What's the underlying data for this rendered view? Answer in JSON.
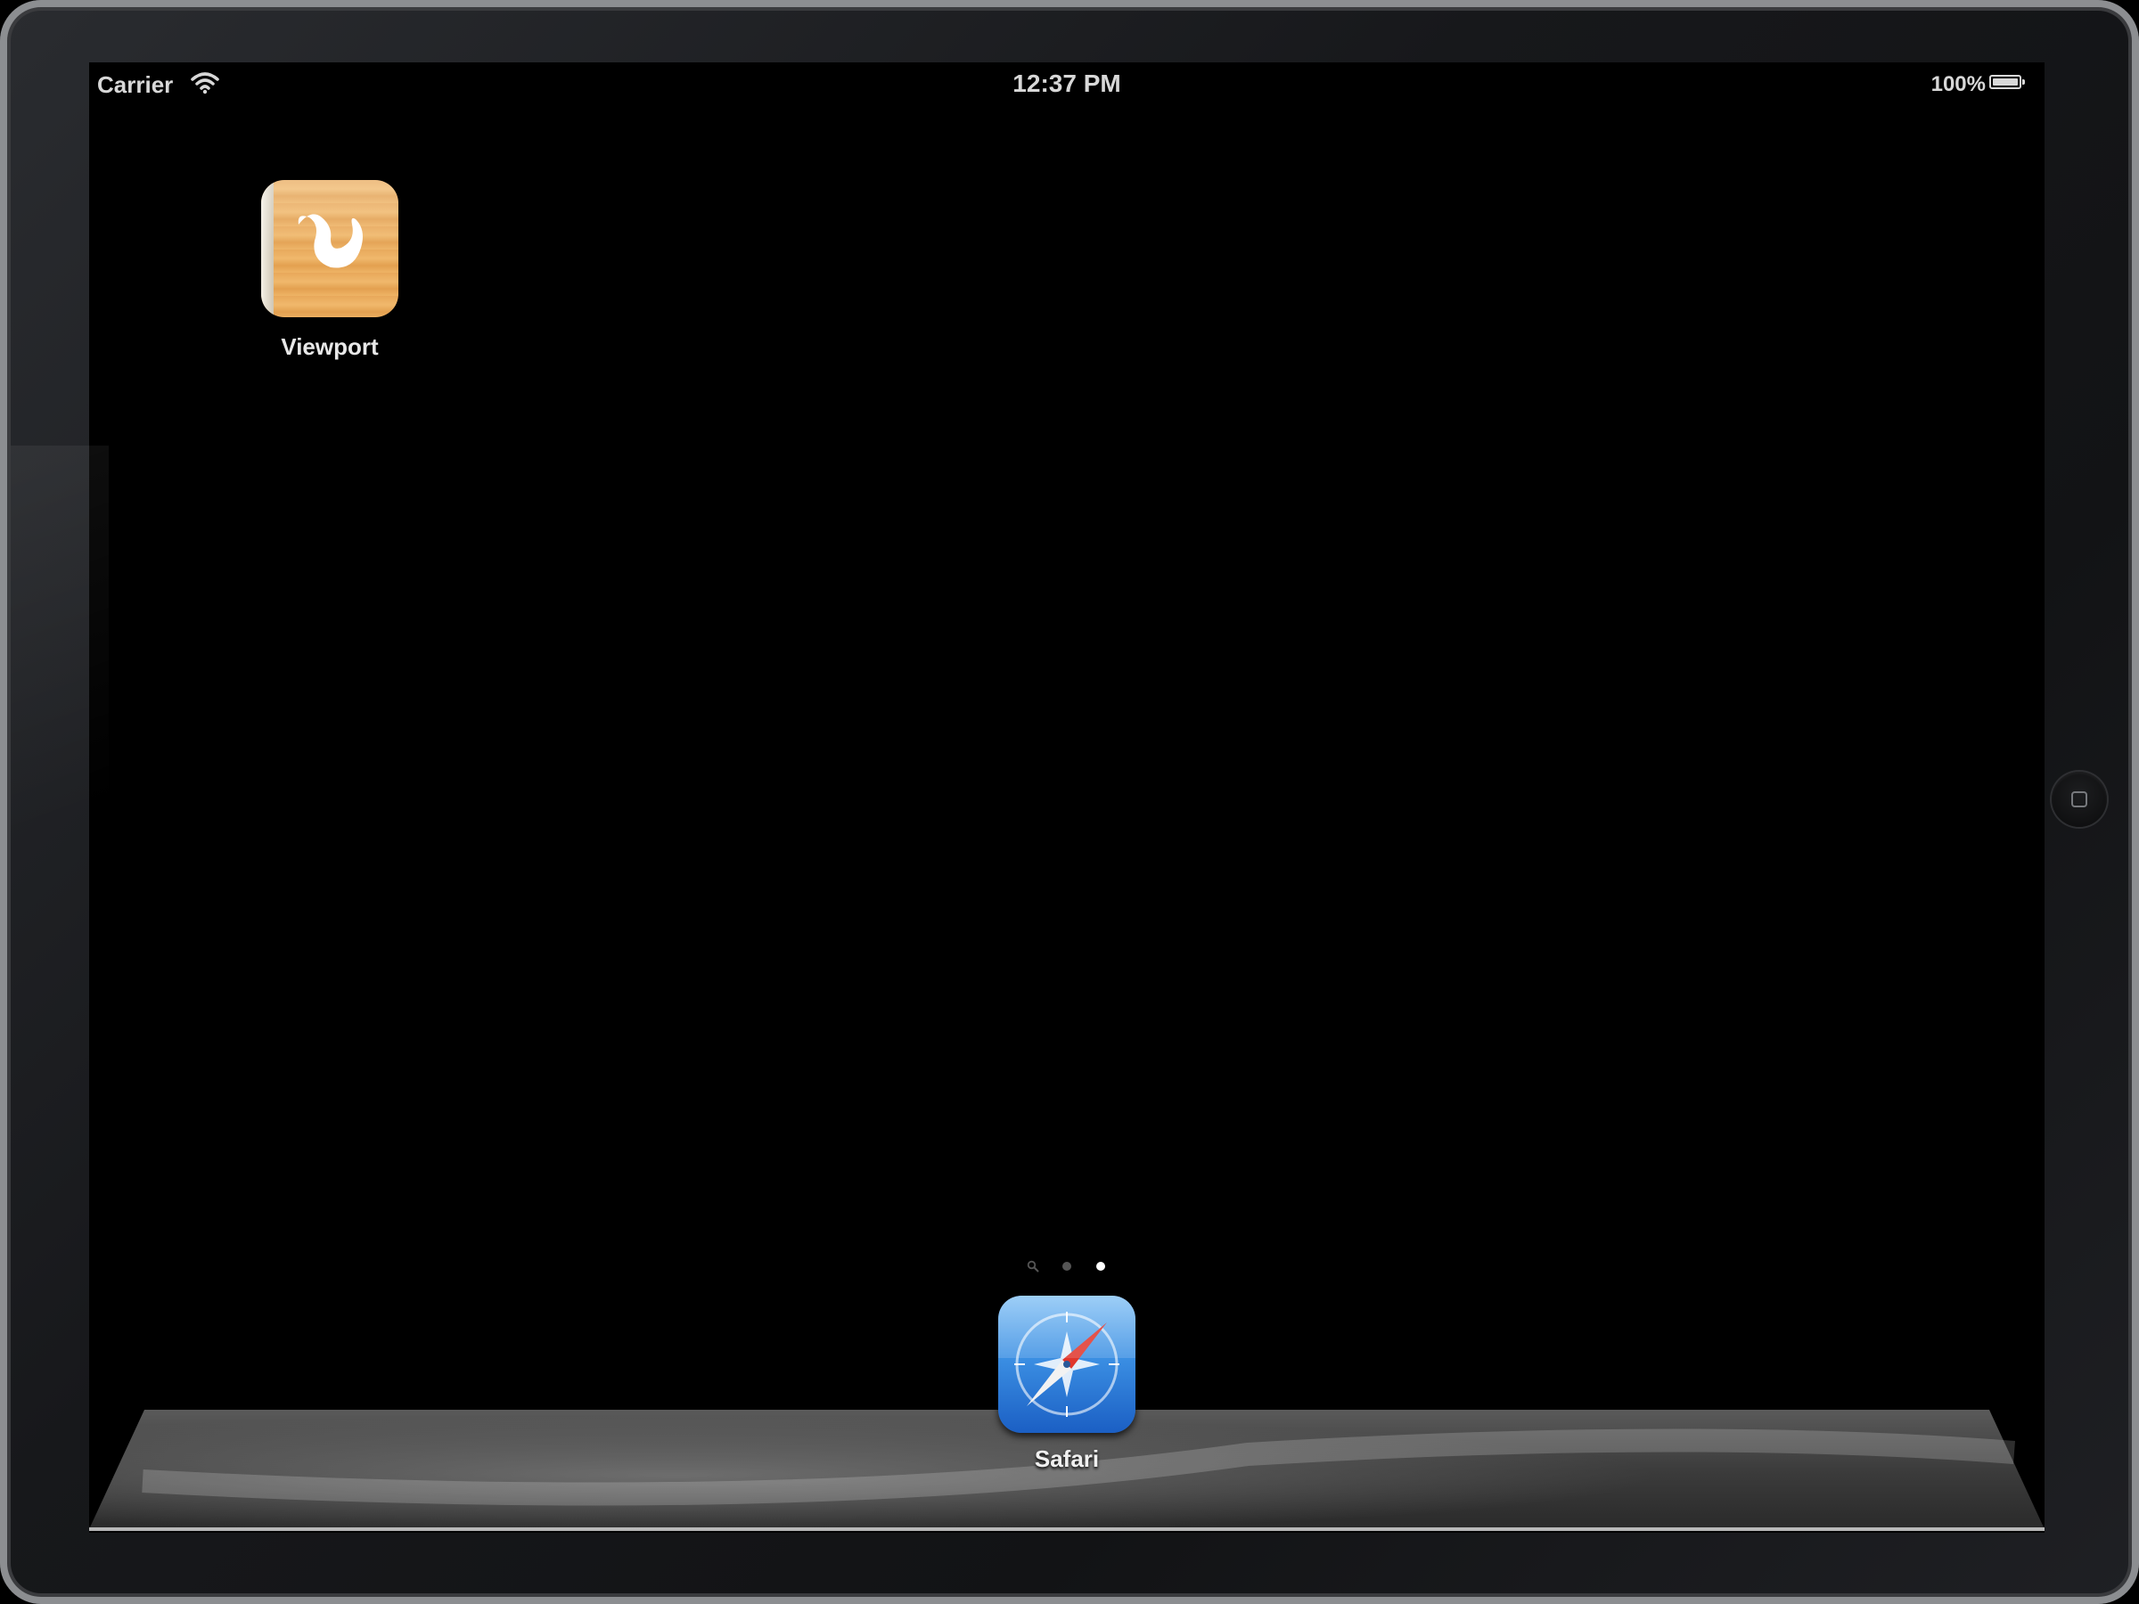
{
  "status_bar": {
    "carrier": "Carrier",
    "time": "12:37 PM",
    "battery_percent": "100%",
    "battery_level": 1.0
  },
  "home_screen": {
    "apps": [
      {
        "label": "Viewport",
        "icon": "viewport-icon"
      }
    ],
    "page_indicator": {
      "pages": 3,
      "current_page": 3,
      "first_is_spotlight": true
    }
  },
  "dock": {
    "apps": [
      {
        "label": "Safari",
        "icon": "safari-compass-icon"
      }
    ]
  },
  "hardware": {
    "home_button": "home-button-icon"
  },
  "colors": {
    "background": "#000000",
    "bezel": "#17181b",
    "bezel_edge": "#8c8e91",
    "label": "#e8e8e8",
    "active_dot": "#ffffff",
    "inactive_dot": "#555555"
  }
}
